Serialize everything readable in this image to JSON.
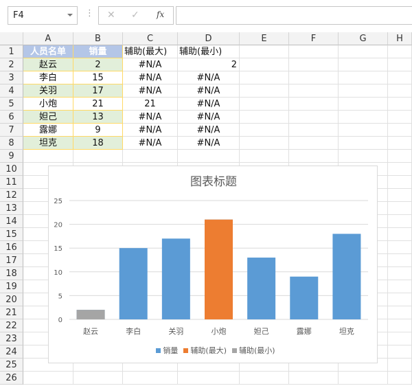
{
  "name_box": "F4",
  "formula_bar": {
    "cancel_icon": "✕",
    "enter_icon": "✓",
    "fx_label": "fx",
    "value": ""
  },
  "columns": [
    "A",
    "B",
    "C",
    "D",
    "E",
    "F",
    "G",
    "H"
  ],
  "rows": [
    "1",
    "2",
    "3",
    "4",
    "5",
    "6",
    "7",
    "8",
    "9",
    "10",
    "11",
    "12",
    "13",
    "14",
    "15",
    "16",
    "17",
    "18",
    "19",
    "20",
    "21",
    "22",
    "23",
    "24",
    "25",
    "26"
  ],
  "cells": [
    [
      "人员名单",
      "销量",
      "辅助(最大)",
      "辅助(最小)"
    ],
    [
      "赵云",
      "2",
      "#N/A",
      "2"
    ],
    [
      "李白",
      "15",
      "#N/A",
      "#N/A"
    ],
    [
      "关羽",
      "17",
      "#N/A",
      "#N/A"
    ],
    [
      "小炮",
      "21",
      "21",
      "#N/A"
    ],
    [
      "妲己",
      "13",
      "#N/A",
      "#N/A"
    ],
    [
      "露娜",
      "9",
      "#N/A",
      "#N/A"
    ],
    [
      "坦克",
      "18",
      "#N/A",
      "#N/A"
    ]
  ],
  "colors": {
    "header_fill": "#b4c6e7",
    "band_fill": "#e2efda",
    "border": "#ffd966",
    "blue": "#5b9bd5",
    "orange": "#ed7d31",
    "gray": "#a5a5a5"
  },
  "chart_data": {
    "type": "bar",
    "title": "图表标题",
    "categories": [
      "赵云",
      "李白",
      "关羽",
      "小炮",
      "妲己",
      "露娜",
      "坦克"
    ],
    "series": [
      {
        "name": "销量",
        "color": "#5b9bd5",
        "values": [
          2,
          15,
          17,
          21,
          13,
          9,
          18
        ]
      },
      {
        "name": "辅助(最大)",
        "color": "#ed7d31",
        "values": [
          null,
          null,
          null,
          21,
          null,
          null,
          null
        ]
      },
      {
        "name": "辅助(最小)",
        "color": "#a5a5a5",
        "values": [
          2,
          null,
          null,
          null,
          null,
          null,
          null
        ]
      }
    ],
    "yticks": [
      "0",
      "5",
      "10",
      "15",
      "20",
      "25"
    ],
    "ylim": [
      0,
      25
    ],
    "grid": true,
    "legend": "bottom"
  }
}
